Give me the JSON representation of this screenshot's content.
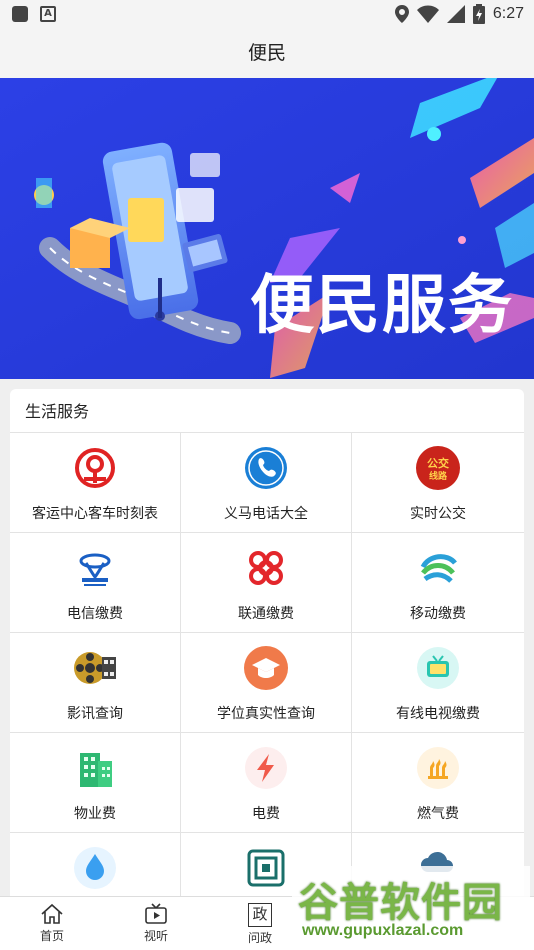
{
  "status_bar": {
    "time": "6:27"
  },
  "header": {
    "title": "便民"
  },
  "banner": {
    "text": "便民服务",
    "dots": 2,
    "active_dot": 1
  },
  "section": {
    "title": "生活服务",
    "items": [
      {
        "label": "客运中心客车时刻表",
        "icon": "railway-icon"
      },
      {
        "label": "义马电话大全",
        "icon": "phone-icon"
      },
      {
        "label": "实时公交",
        "icon": "bus-icon"
      },
      {
        "label": "电信缴费",
        "icon": "china-telecom-icon"
      },
      {
        "label": "联通缴费",
        "icon": "china-unicom-icon"
      },
      {
        "label": "移动缴费",
        "icon": "china-mobile-icon"
      },
      {
        "label": "影讯查询",
        "icon": "film-reel-icon"
      },
      {
        "label": "学位真实性查询",
        "icon": "graduation-cap-icon"
      },
      {
        "label": "有线电视缴费",
        "icon": "tv-icon"
      },
      {
        "label": "物业费",
        "icon": "building-icon"
      },
      {
        "label": "电费",
        "icon": "lightning-icon"
      },
      {
        "label": "燃气费",
        "icon": "gas-flame-icon"
      },
      {
        "label": "",
        "icon": "water-drop-icon"
      },
      {
        "label": "",
        "icon": "seal-icon"
      },
      {
        "label": "",
        "icon": "weather-cloud-icon"
      }
    ]
  },
  "watermark": {
    "text": "谷普软件园",
    "url": "www.gupuxlazal.com"
  },
  "bottom_nav": [
    {
      "label": "首页",
      "icon": "home-icon"
    },
    {
      "label": "视听",
      "icon": "tv-play-icon"
    },
    {
      "label": "问政",
      "icon": "zheng-icon",
      "glyph": "政"
    },
    {
      "label": "",
      "icon": "hidden-icon"
    },
    {
      "label": "",
      "icon": "hidden-icon"
    }
  ]
}
